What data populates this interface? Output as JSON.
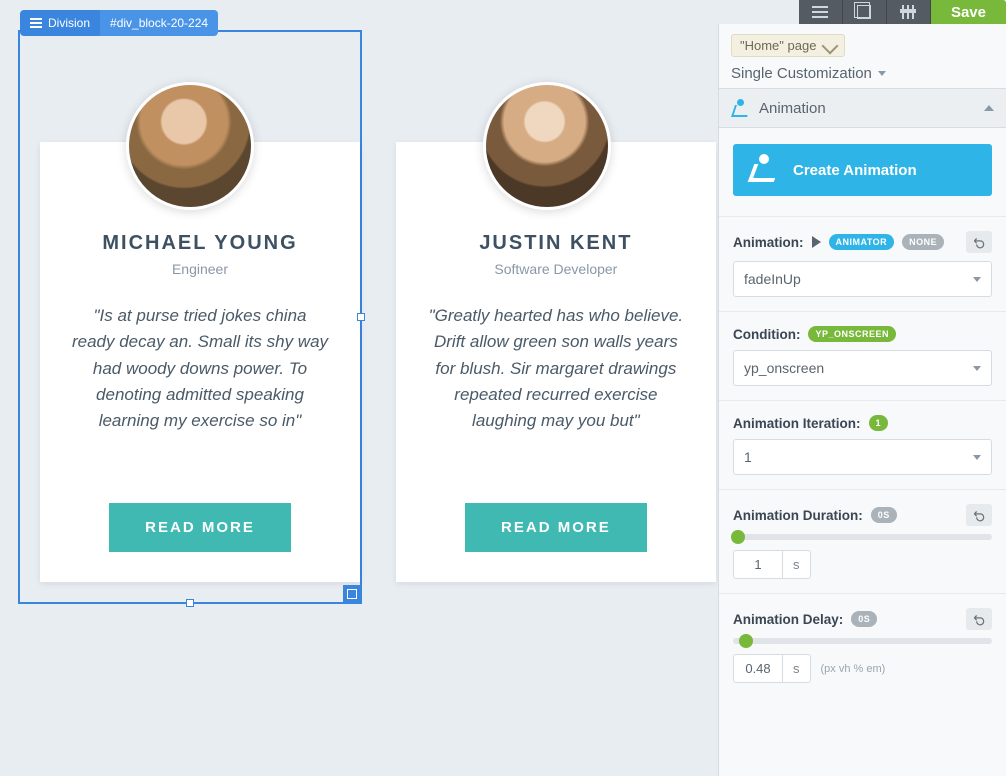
{
  "topbar": {
    "save_label": "Save"
  },
  "selection": {
    "type_label": "Division",
    "id_label": "#div_block-20-224"
  },
  "cards": [
    {
      "name": "MICHAEL YOUNG",
      "role": "Engineer",
      "quote": "\"Is at purse tried jokes china ready decay an. Small its shy way had woody downs power. To denoting admitted speaking learning my exercise so in\"",
      "button": "READ MORE"
    },
    {
      "name": "JUSTIN KENT",
      "role": "Software Developer",
      "quote": "\"Greatly hearted has who believe. Drift allow green son walls years for blush. Sir margaret drawings repeated recurred exercise laughing may you but\"",
      "button": "READ MORE"
    }
  ],
  "panel": {
    "context": "\"Home\" page",
    "customization": "Single Customization",
    "section_title": "Animation",
    "create_btn": "Create Animation",
    "animation": {
      "label": "Animation:",
      "pill_animator": "ANIMATOR",
      "pill_none": "NONE",
      "value": "fadeInUp"
    },
    "condition": {
      "label": "Condition:",
      "pill": "YP_ONSCREEN",
      "value": "yp_onscreen"
    },
    "iteration": {
      "label": "Animation Iteration:",
      "pill": "1",
      "value": "1"
    },
    "duration": {
      "label": "Animation Duration:",
      "pill": "0S",
      "value": "1",
      "unit": "s",
      "thumb_percent": 2
    },
    "delay": {
      "label": "Animation Delay:",
      "pill": "0S",
      "value": "0.48",
      "unit": "s",
      "hints": "(px vh % em)",
      "thumb_percent": 5
    }
  }
}
